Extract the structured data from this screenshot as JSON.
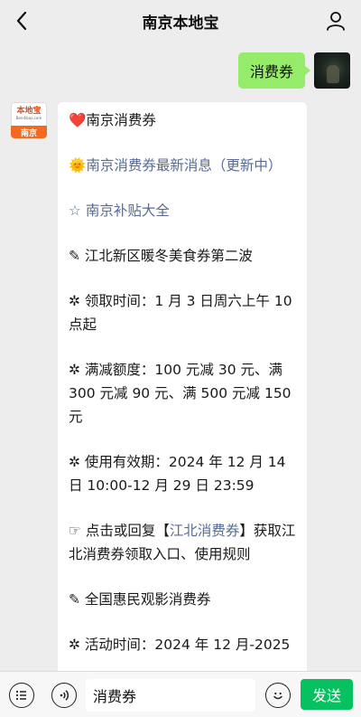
{
  "header": {
    "title": "南京本地宝"
  },
  "outgoing_message": {
    "text": "消费券"
  },
  "bot_avatar": {
    "logo_main": "本地宝",
    "logo_sub": "Bendibao.com",
    "city": "南京"
  },
  "incoming_message": {
    "lines": [
      {
        "prefix": "❤️",
        "text": "南京消费券",
        "link": false
      },
      {
        "prefix": "🌞",
        "text": "南京消费券最新消息（更新中）",
        "link": true
      },
      {
        "prefix": "☆ ",
        "text": "南京补贴大全",
        "link": true
      },
      {
        "prefix": "✎ ",
        "text": "江北新区暖冬美食券第二波",
        "link": false
      },
      {
        "prefix": "✲ ",
        "text": "领取时间：1 月 3 日周六上午 10 点起",
        "link": false
      },
      {
        "prefix": "✲ ",
        "text": "满减额度：100 元减 30 元、满 300 元减 90 元、满 500 元减 150 元",
        "link": false
      },
      {
        "prefix": "✲ ",
        "text": "使用有效期：2024 年 12 月 14 日 10:00-12 月 29 日 23:59",
        "link": false
      },
      {
        "prefix": "☞ ",
        "text_before": "点击或回复【",
        "link_text": "江北消费券",
        "text_after": "】获取江北消费券领取入口、使用规则",
        "mixed": true
      },
      {
        "prefix": "✎ ",
        "text": "全国惠民观影消费券",
        "link": false
      },
      {
        "prefix": "✲ ",
        "text": "活动时间：2024 年 12 月-2025",
        "link": false
      }
    ]
  },
  "input_bar": {
    "value": "消费券",
    "send_label": "发送"
  },
  "colors": {
    "bubble_out": "#95ec69",
    "link": "#576b95",
    "send": "#07c160",
    "brand_orange": "#f26a21"
  }
}
